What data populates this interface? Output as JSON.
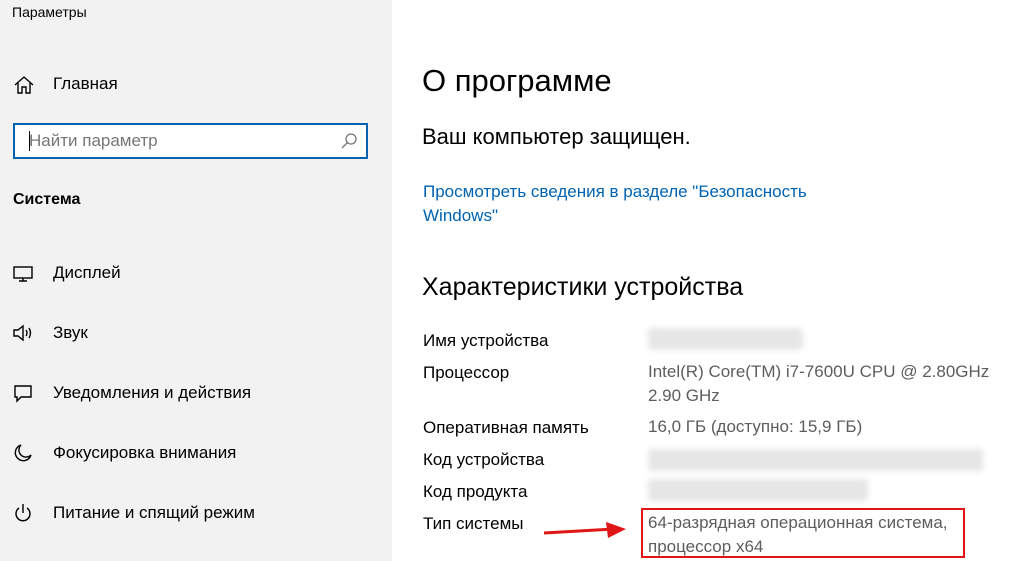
{
  "window": {
    "title": "Параметры"
  },
  "sidebar": {
    "home_label": "Главная",
    "search": {
      "placeholder": "Найти параметр",
      "value": ""
    },
    "section_title": "Система",
    "items": [
      {
        "label": "Дисплей",
        "icon": "display-icon"
      },
      {
        "label": "Звук",
        "icon": "speaker-icon"
      },
      {
        "label": "Уведомления и действия",
        "icon": "notification-icon"
      },
      {
        "label": "Фокусировка внимания",
        "icon": "moon-icon"
      },
      {
        "label": "Питание и спящий режим",
        "icon": "power-icon"
      }
    ]
  },
  "main": {
    "title": "О программе",
    "protected_text": "Ваш компьютер защищен.",
    "security_link": "Просмотреть сведения в разделе \"Безопасность Windows\"",
    "specs_title": "Характеристики устройства",
    "specs": {
      "device_name_label": "Имя устройства",
      "processor_label": "Процессор",
      "processor_value": "Intel(R) Core(TM) i7-7600U CPU @ 2.80GHz 2.90 GHz",
      "ram_label": "Оперативная память",
      "ram_value": "16,0 ГБ (доступно: 15,9 ГБ)",
      "device_id_label": "Код устройства",
      "product_id_label": "Код продукта",
      "system_type_label": "Тип системы",
      "system_type_value": "64-разрядная операционная система, процессор x64"
    }
  },
  "colors": {
    "accent": "#0063b1",
    "annotation": "#e01515",
    "sidebar_bg": "#f2f2f2"
  }
}
